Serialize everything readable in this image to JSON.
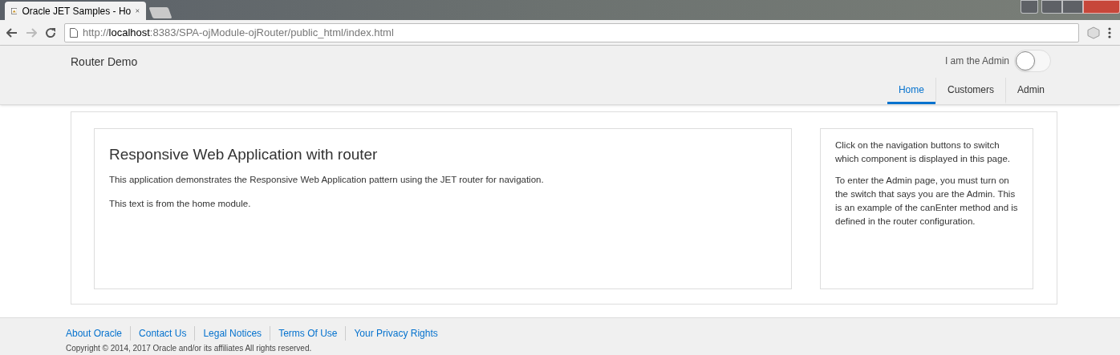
{
  "browser": {
    "tab_title": "Oracle JET Samples - Ho",
    "url_prefix": "http://",
    "url_host": "localhost",
    "url_rest": ":8383/SPA-ojModule-ojRouter/public_html/index.html"
  },
  "header": {
    "title": "Router Demo",
    "switch_label": "I am the Admin",
    "switch_on": false
  },
  "nav_tabs": [
    {
      "label": "Home",
      "selected": true
    },
    {
      "label": "Customers",
      "selected": false
    },
    {
      "label": "Admin",
      "selected": false
    }
  ],
  "main": {
    "heading": "Responsive Web Application with router",
    "paragraphs": [
      "This application demonstrates the Responsive Web Application pattern using the JET router for navigation.",
      "This text is from the home module."
    ]
  },
  "aside": {
    "paragraphs": [
      "Click on the navigation buttons to switch which component is displayed in this page.",
      "To enter the Admin page, you must turn on the switch that says you are the Admin. This is an example of the canEnter method and is defined in the router configuration."
    ]
  },
  "footer": {
    "links": [
      "About Oracle",
      "Contact Us",
      "Legal Notices",
      "Terms Of Use",
      "Your Privacy Rights"
    ],
    "copyright": "Copyright © 2014, 2017 Oracle and/or its affiliates All rights reserved."
  }
}
